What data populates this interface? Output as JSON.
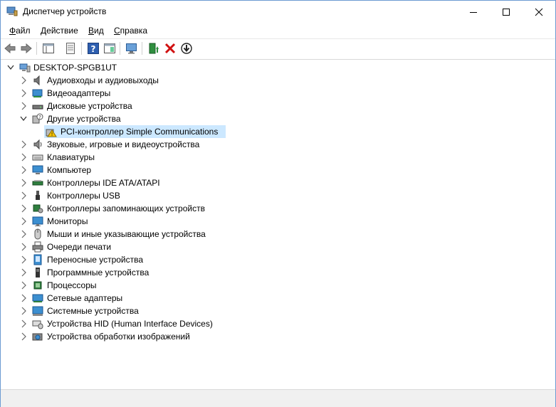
{
  "window": {
    "title": "Диспетчер устройств"
  },
  "menu": [
    {
      "first": "Ф",
      "rest": "айл"
    },
    {
      "first": "Д",
      "rest": "ействие"
    },
    {
      "first": "В",
      "rest": "ид"
    },
    {
      "first": "С",
      "rest": "правка"
    }
  ],
  "tree": {
    "root": "DESKTOP-SPGB1UT",
    "items": [
      {
        "label": "Аудиовходы и аудиовыходы",
        "icon": "audio-icon",
        "expanded": false
      },
      {
        "label": "Видеоадаптеры",
        "icon": "display-adapter-icon",
        "expanded": false
      },
      {
        "label": "Дисковые устройства",
        "icon": "disk-drive-icon",
        "expanded": false
      },
      {
        "label": "Другие устройства",
        "icon": "unknown-device-icon",
        "expanded": true
      },
      {
        "label": "PCI-контроллер Simple Communications",
        "icon": "warning-device-icon",
        "child": true,
        "selected": true
      },
      {
        "label": "Звуковые, игровые и видеоустройства",
        "icon": "sound-icon",
        "expanded": false
      },
      {
        "label": "Клавиатуры",
        "icon": "keyboard-icon",
        "expanded": false
      },
      {
        "label": "Компьютер",
        "icon": "computer-icon",
        "expanded": false
      },
      {
        "label": "Контроллеры IDE ATA/ATAPI",
        "icon": "ide-controller-icon",
        "expanded": false
      },
      {
        "label": "Контроллеры USB",
        "icon": "usb-icon",
        "expanded": false
      },
      {
        "label": "Контроллеры запоминающих устройств",
        "icon": "storage-controller-icon",
        "expanded": false
      },
      {
        "label": "Мониторы",
        "icon": "monitor-icon",
        "expanded": false
      },
      {
        "label": "Мыши и иные указывающие устройства",
        "icon": "mouse-icon",
        "expanded": false
      },
      {
        "label": "Очереди печати",
        "icon": "printer-icon",
        "expanded": false
      },
      {
        "label": "Переносные устройства",
        "icon": "portable-device-icon",
        "expanded": false
      },
      {
        "label": "Программные устройства",
        "icon": "software-device-icon",
        "expanded": false
      },
      {
        "label": "Процессоры",
        "icon": "processor-icon",
        "expanded": false
      },
      {
        "label": "Сетевые адаптеры",
        "icon": "network-adapter-icon",
        "expanded": false
      },
      {
        "label": "Системные устройства",
        "icon": "system-device-icon",
        "expanded": false
      },
      {
        "label": "Устройства HID (Human Interface Devices)",
        "icon": "hid-icon",
        "expanded": false
      },
      {
        "label": "Устройства обработки изображений",
        "icon": "imaging-device-icon",
        "expanded": false
      }
    ]
  }
}
